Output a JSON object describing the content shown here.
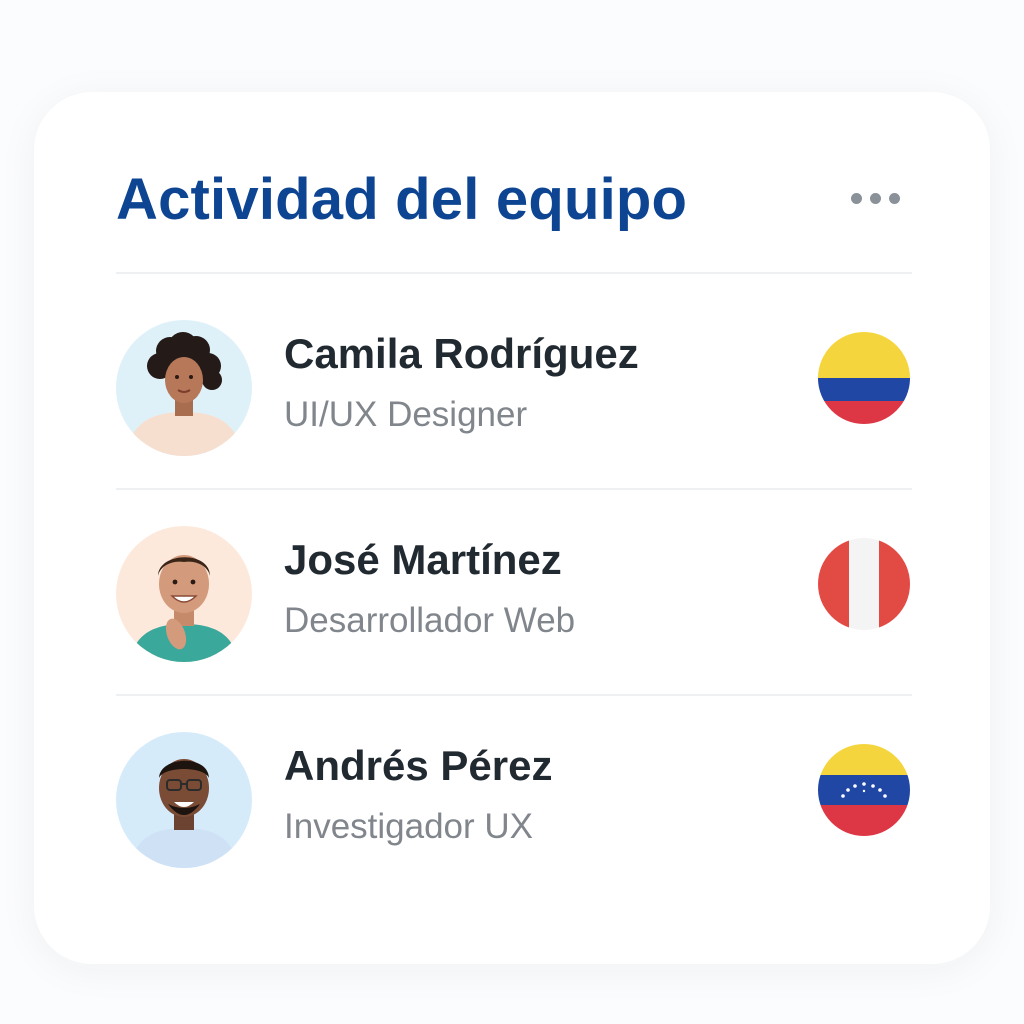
{
  "header": {
    "title": "Actividad del equipo",
    "more_icon": "more-horizontal-icon"
  },
  "members": [
    {
      "name": "Camila Rodríguez",
      "role": "UI/UX Designer",
      "flag": "colombia-flag-icon",
      "avatar_bg": "#dff1f8"
    },
    {
      "name": "José Martínez",
      "role": "Desarrollador Web",
      "flag": "peru-flag-icon",
      "avatar_bg": "#fde9dc"
    },
    {
      "name": "Andrés Pérez",
      "role": "Investigador UX",
      "flag": "venezuela-flag-icon",
      "avatar_bg": "#d6ebfa"
    }
  ],
  "colors": {
    "title": "#0d4592",
    "name": "#222a31",
    "role": "#80868c",
    "divider": "#eef0f2"
  }
}
